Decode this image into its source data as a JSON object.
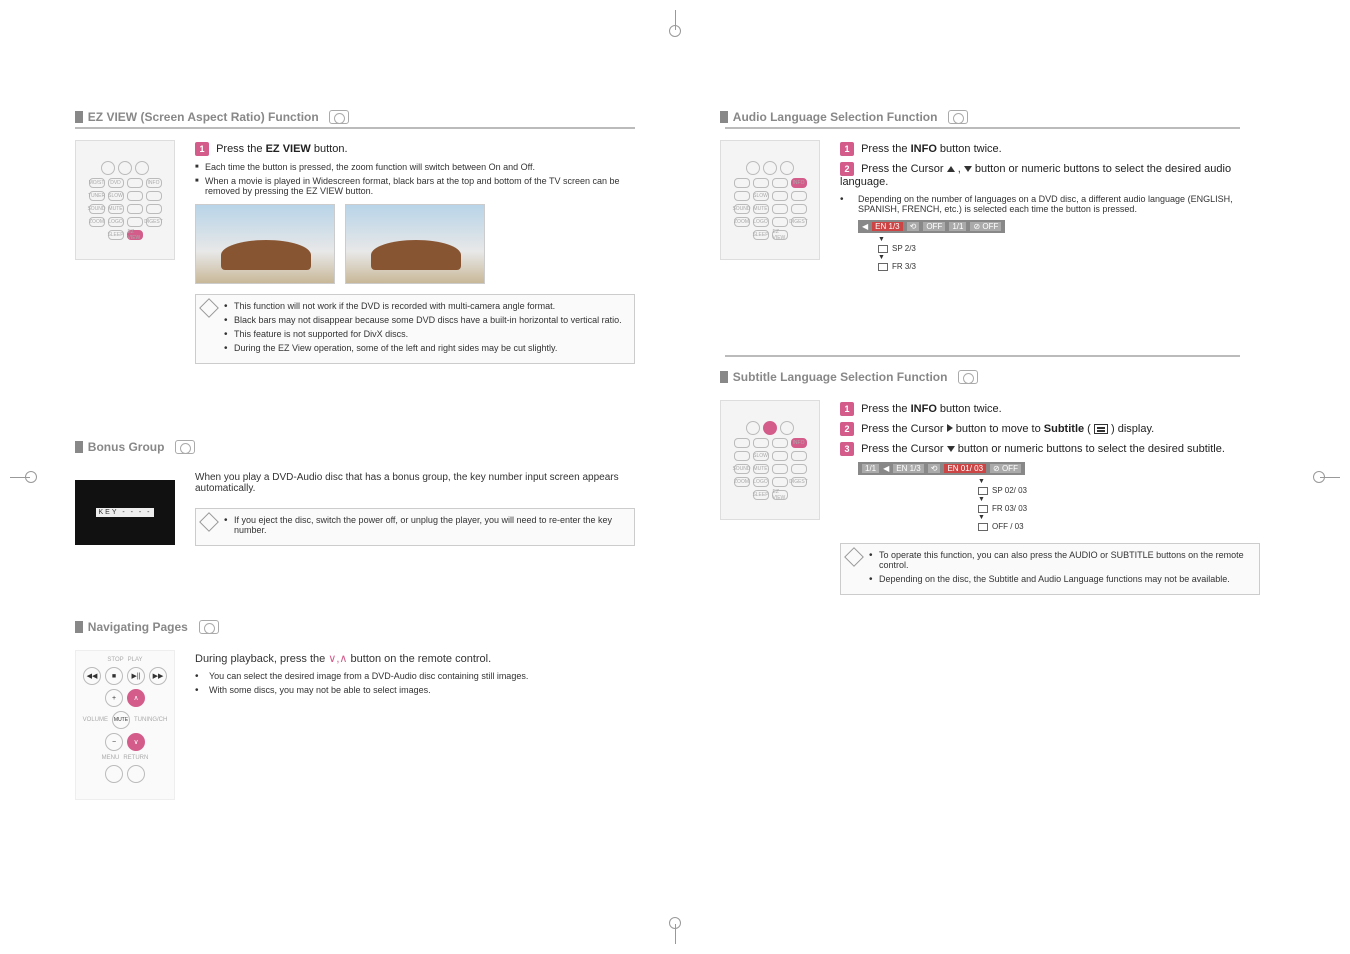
{
  "left": {
    "ezview": {
      "heading": "EZ VIEW (Screen Aspect Ratio) Function",
      "step1_a": "Press the ",
      "step1_b": "EZ VIEW",
      "step1_c": " button.",
      "b1": "Each time the button is pressed, the zoom function will switch between On and Off.",
      "b2": "When a movie is played in Widescreen format, black bars at the top and bottom of the TV screen can be removed by pressing the EZ VIEW button.",
      "note1": "This function will not work if the DVD is recorded with multi-camera angle format.",
      "note2": "Black bars may not disappear because some DVD discs have a built-in horizontal to vertical ratio.",
      "note3": "This feature is not supported for DivX discs.",
      "note4": "During the EZ View operation, some of the left and right sides may be cut slightly."
    },
    "bonus": {
      "heading": "Bonus Group",
      "field": "KEY - - - -",
      "body": "When you play a DVD-Audio disc that has a bonus group, the key number input screen appears automatically.",
      "note": "If you eject the disc, switch the power off, or unplug the player, you will need to re-enter the key number."
    },
    "nav": {
      "heading": "Navigating Pages",
      "remote_labels": {
        "stop": "STOP",
        "play": "PLAY",
        "volume": "VOLUME",
        "mute": "MUTE",
        "tuning": "TUNING/CH",
        "menu": "MENU",
        "return": "RETURN"
      },
      "line1": "During playback, press the ",
      "line1b": " button on the remote control.",
      "sub1": "You can select the desired image from a DVD-Audio disc containing still images.",
      "sub2": "With some discs, you may not be able to select images."
    }
  },
  "right": {
    "audio": {
      "heading": "Audio Language Selection Function",
      "step1_a": "Press the ",
      "step1_b": "INFO",
      "step1_c": " button twice.",
      "step2_a": "Press the Cursor ",
      "step2_b": " button or numeric buttons to select the desired audio language.",
      "sub": "Depending on the number of languages on a DVD disc, a different audio language (ENGLISH, SPANISH, FRENCH, etc.) is selected each time the button is pressed.",
      "osd_main": "EN 1/3",
      "osd_items": [
        "SP 2/3",
        "FR 3/3"
      ]
    },
    "subtitle": {
      "heading": "Subtitle Language Selection Function",
      "step1_a": "Press the ",
      "step1_b": "INFO",
      "step1_c": " button twice.",
      "step2_a": "Press the Cursor ",
      "step2_b": " button to move to ",
      "step2_c": "Subtitle",
      "step2_d": " display.",
      "step3_a": "Press the Cursor ",
      "step3_b": " button or numeric buttons to select the desired subtitle.",
      "osd_main": "EN 01/ 03",
      "osd_prefix": "EN 1/3",
      "osd_items": [
        "SP 02/ 03",
        "FR 03/ 03",
        "OFF / 03"
      ],
      "note1": "To operate this function, you can also press the AUDIO or SUBTITLE buttons on the remote control.",
      "note2": "Depending on the disc, the Subtitle and Audio Language functions may not be available."
    }
  }
}
